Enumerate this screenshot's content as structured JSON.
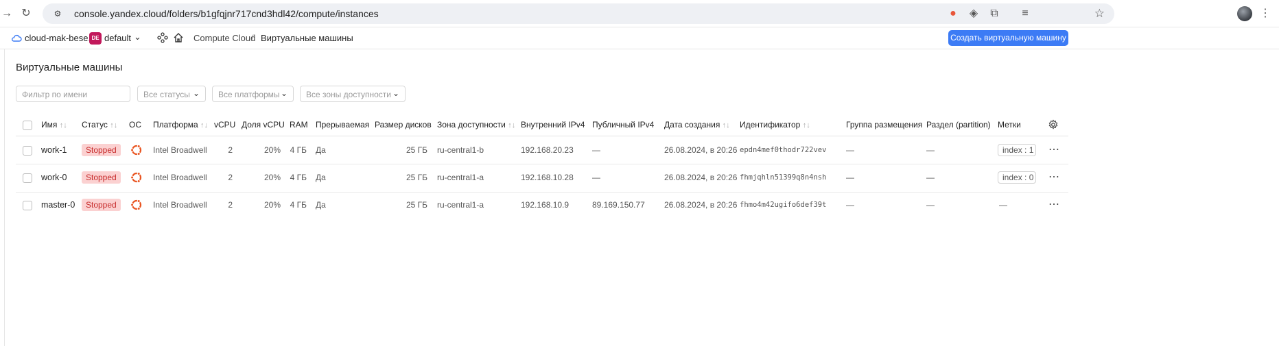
{
  "browser": {
    "url": "console.yandex.cloud/folders/b1gfqjnr717cnd3hdl42/compute/instances"
  },
  "header": {
    "cloud_name": "cloud-mak-bese...",
    "folder_badge": "DE",
    "folder_name": "default",
    "breadcrumbs": [
      "Compute Cloud",
      "/",
      "Виртуальные машины"
    ],
    "create_button": "Создать виртуальную машину"
  },
  "page": {
    "title": "Виртуальные машины"
  },
  "filters": {
    "name_placeholder": "Фильтр по имени",
    "status": "Все статусы",
    "platform": "Все платформы",
    "zone": "Все зоны доступности"
  },
  "columns": {
    "name": "Имя",
    "status": "Статус",
    "os": "ОС",
    "platform": "Платформа",
    "vcpu": "vCPU",
    "vcpu_share": "Доля vCPU",
    "ram": "RAM",
    "preemptible": "Прерываемая",
    "disk_size": "Размер дисков",
    "zone": "Зона доступности",
    "internal_ip": "Внутренний IPv4",
    "public_ip": "Публичный IPv4",
    "created": "Дата создания",
    "id": "Идентификатор",
    "placement_group": "Группа размещения",
    "partition": "Раздел (partition)",
    "labels": "Метки"
  },
  "sort_glyph": "↑↓",
  "rows": [
    {
      "name": "work-1",
      "status": "Stopped",
      "os": "ubuntu-icon",
      "platform": "Intel Broadwell",
      "vcpu": "2",
      "vcpu_share": "20%",
      "ram": "4 ГБ",
      "preemptible": "Да",
      "disk_size": "25 ГБ",
      "zone": "ru-central1-b",
      "internal_ip": "192.168.20.23",
      "public_ip": "—",
      "created": "26.08.2024, в 20:26",
      "id": "epdn4mef0thodr722vev",
      "placement_group": "—",
      "partition": "—",
      "label": "index : 1"
    },
    {
      "name": "work-0",
      "status": "Stopped",
      "os": "ubuntu-icon",
      "platform": "Intel Broadwell",
      "vcpu": "2",
      "vcpu_share": "20%",
      "ram": "4 ГБ",
      "preemptible": "Да",
      "disk_size": "25 ГБ",
      "zone": "ru-central1-a",
      "internal_ip": "192.168.10.28",
      "public_ip": "—",
      "created": "26.08.2024, в 20:26",
      "id": "fhmjqhln51399q8n4nsh",
      "placement_group": "—",
      "partition": "—",
      "label": "index : 0"
    },
    {
      "name": "master-0",
      "status": "Stopped",
      "os": "ubuntu-icon",
      "platform": "Intel Broadwell",
      "vcpu": "2",
      "vcpu_share": "20%",
      "ram": "4 ГБ",
      "preemptible": "Да",
      "disk_size": "25 ГБ",
      "zone": "ru-central1-a",
      "internal_ip": "192.168.10.9",
      "public_ip": "89.169.150.77",
      "created": "26.08.2024, в 20:26",
      "id": "fhmo4m42ugifo6def39t",
      "placement_group": "—",
      "partition": "—",
      "label": "—"
    }
  ],
  "colors": {
    "accent": "#3c7bf5",
    "status_bg": "#fbd1d1",
    "status_text": "#c62828",
    "ubuntu": "#e95420"
  }
}
